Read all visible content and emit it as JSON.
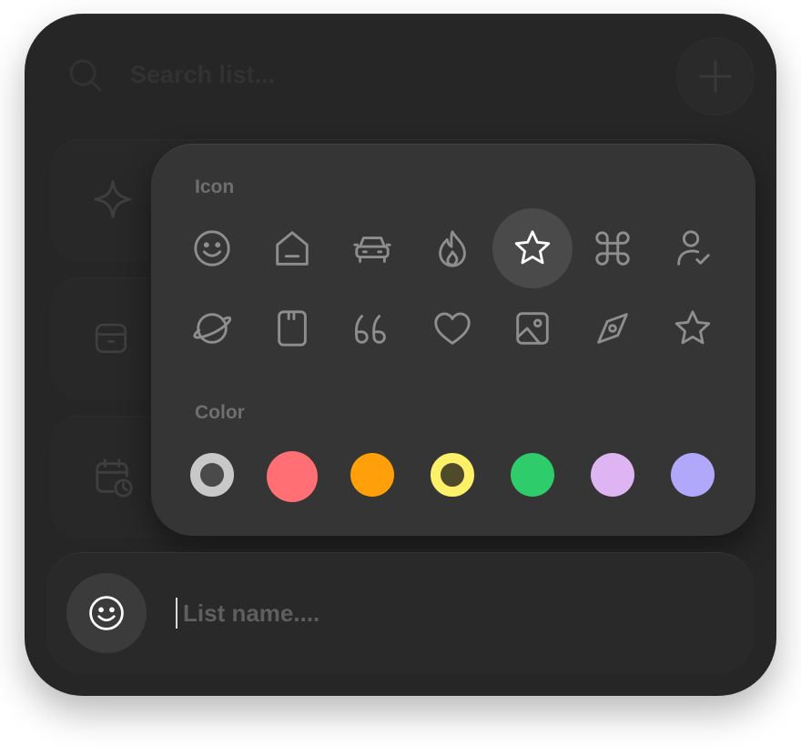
{
  "search": {
    "placeholder": "Search list..."
  },
  "icon_section": {
    "label": "Icon",
    "icons": [
      "smile-icon",
      "home-icon",
      "car-icon",
      "flame-icon",
      "star-icon",
      "command-icon",
      "user-check-icon",
      "planet-icon",
      "sd-card-icon",
      "quote-icon",
      "heart-icon",
      "image-icon",
      "compass-icon",
      "star-outline-icon"
    ],
    "selected": "star-icon"
  },
  "color_section": {
    "label": "Color",
    "colors": [
      {
        "name": "gray",
        "value": "#c8c8c8",
        "selected": true
      },
      {
        "name": "red",
        "value": "#ff6f73"
      },
      {
        "name": "orange",
        "value": "#ff9f0a"
      },
      {
        "name": "yellow",
        "value": "#fff06a",
        "selected": true
      },
      {
        "name": "green",
        "value": "#2fcc6b"
      },
      {
        "name": "lavender",
        "value": "#dfb4f3"
      },
      {
        "name": "periwinkle",
        "value": "#b2a8fb"
      }
    ]
  },
  "list_name": {
    "placeholder": "List name...."
  },
  "theme": {
    "background": "#262626",
    "popover": "#353535",
    "icon_stroke": "#8e8e8e",
    "selected_icon_stroke": "#ffffff"
  }
}
